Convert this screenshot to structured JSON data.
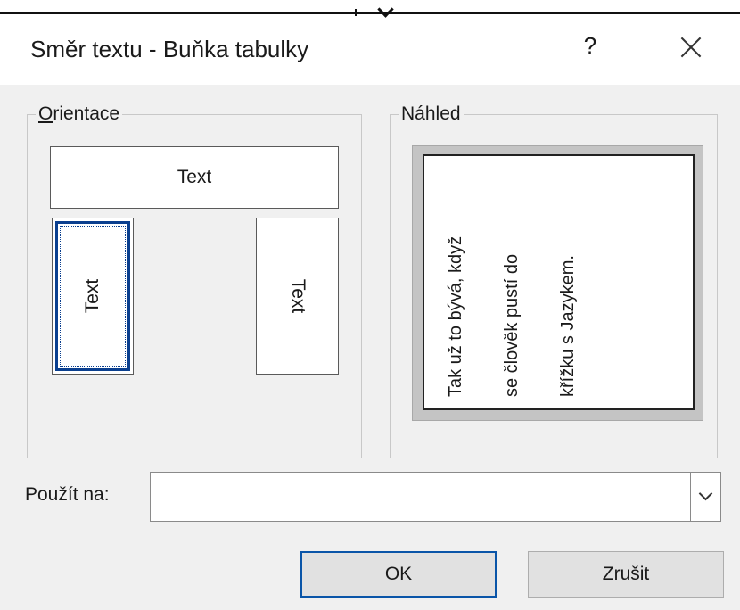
{
  "dialog": {
    "title": "Směr textu - Buňka tabulky",
    "help_label": "?",
    "close_icon": "close-icon"
  },
  "orientation": {
    "label_accel": "O",
    "label_rest": "rientace",
    "options": [
      {
        "label": "Text",
        "direction": "horizontal",
        "selected": false
      },
      {
        "label": "Text",
        "direction": "bottom-to-top",
        "selected": true
      },
      {
        "label": "Text",
        "direction": "top-to-bottom",
        "selected": false
      }
    ]
  },
  "preview": {
    "label": "Náhled",
    "lines": [
      "Tak už to bývá, když",
      "se člověk pustí do",
      "křížku s Jazykem."
    ]
  },
  "apply_to": {
    "label": "Použít na:",
    "value": ""
  },
  "buttons": {
    "ok": "OK",
    "cancel": "Zrušit"
  },
  "colors": {
    "focus_blue": "#0a55a8",
    "dialog_bg": "#f0f0f0"
  }
}
